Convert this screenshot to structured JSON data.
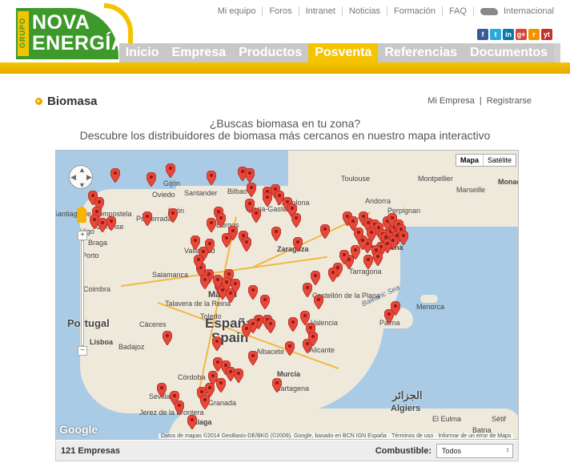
{
  "brand": {
    "small": "GRUPO",
    "line1": "NOVA",
    "line2": "ENERGÍA"
  },
  "topnav": [
    "Mi equipo",
    "Foros",
    "Intranet",
    "Noticias",
    "Formación",
    "FAQ"
  ],
  "international": "Internacional",
  "social": [
    {
      "icon": "facebook-icon",
      "glyph": "f",
      "color": "#3b5998"
    },
    {
      "icon": "twitter-icon",
      "glyph": "t",
      "color": "#2aa9e0"
    },
    {
      "icon": "linkedin-icon",
      "glyph": "in",
      "color": "#0e76a8"
    },
    {
      "icon": "googleplus-icon",
      "glyph": "g+",
      "color": "#d34836"
    },
    {
      "icon": "rss-icon",
      "glyph": "r",
      "color": "#f39200"
    },
    {
      "icon": "youtube-icon",
      "glyph": "yt",
      "color": "#c4302b"
    }
  ],
  "mainnav": [
    "Inicio",
    "Empresa",
    "Productos",
    "Posventa",
    "Referencias",
    "Documentos"
  ],
  "active_nav": "Posventa",
  "page": {
    "title": "Biomasa",
    "my_company": "Mi Empresa",
    "register": "Registrarse",
    "tagline1": "¿Buscas biomasa en tu zona?",
    "tagline2": "Descubre los distribuidores de biomasa más cercanos en nuestro mapa interactivo"
  },
  "map": {
    "type_map": "Mapa",
    "type_satellite": "Satélite",
    "country_es": "España",
    "country_en": "Spain",
    "portugal": "Portugal",
    "andorra": "Andorra",
    "balearic": "Balearic Sea",
    "algeria_ar": "الجزائر",
    "algeria": "Algiers",
    "google": "Google",
    "footer": "Datos de mapas ©2014 GeoBasis-DE/BKG (©2009), Google, basado en BCN IGN España · Términos de uso · Informar de un error de Maps",
    "labels": [
      "Oviedo",
      "Gijón",
      "Santander",
      "Bilbao",
      "Vitoria-Gasteiz",
      "Pamplona",
      "Toulouse",
      "Montpellier",
      "Marseille",
      "Perpignan",
      "Monaco",
      "Ourense",
      "Vigo",
      "Santiago de Compostela",
      "Ponferrada",
      "León",
      "Burgos",
      "Zaragoza",
      "Barcelona",
      "Tarragona",
      "Salamanca",
      "Valladolid",
      "Madrid",
      "Talavera de la Reina",
      "Cáceres",
      "Badajoz",
      "Toledo",
      "Castellón de la Plana",
      "Valencia",
      "Albacete",
      "Alicante",
      "Murcia",
      "Cartagena",
      "Córdoba",
      "Sevilla",
      "Granada",
      "Málaga",
      "Jerez de la Frontera",
      "Lisboa",
      "Porto",
      "Coimbra",
      "Braga",
      "Palma",
      "Menorca",
      "El Eulma",
      "Batna",
      "Sétif"
    ]
  },
  "bottom": {
    "count": "121 Empresas",
    "fuel_label": "Combustible:",
    "fuel_value": "Todos"
  }
}
